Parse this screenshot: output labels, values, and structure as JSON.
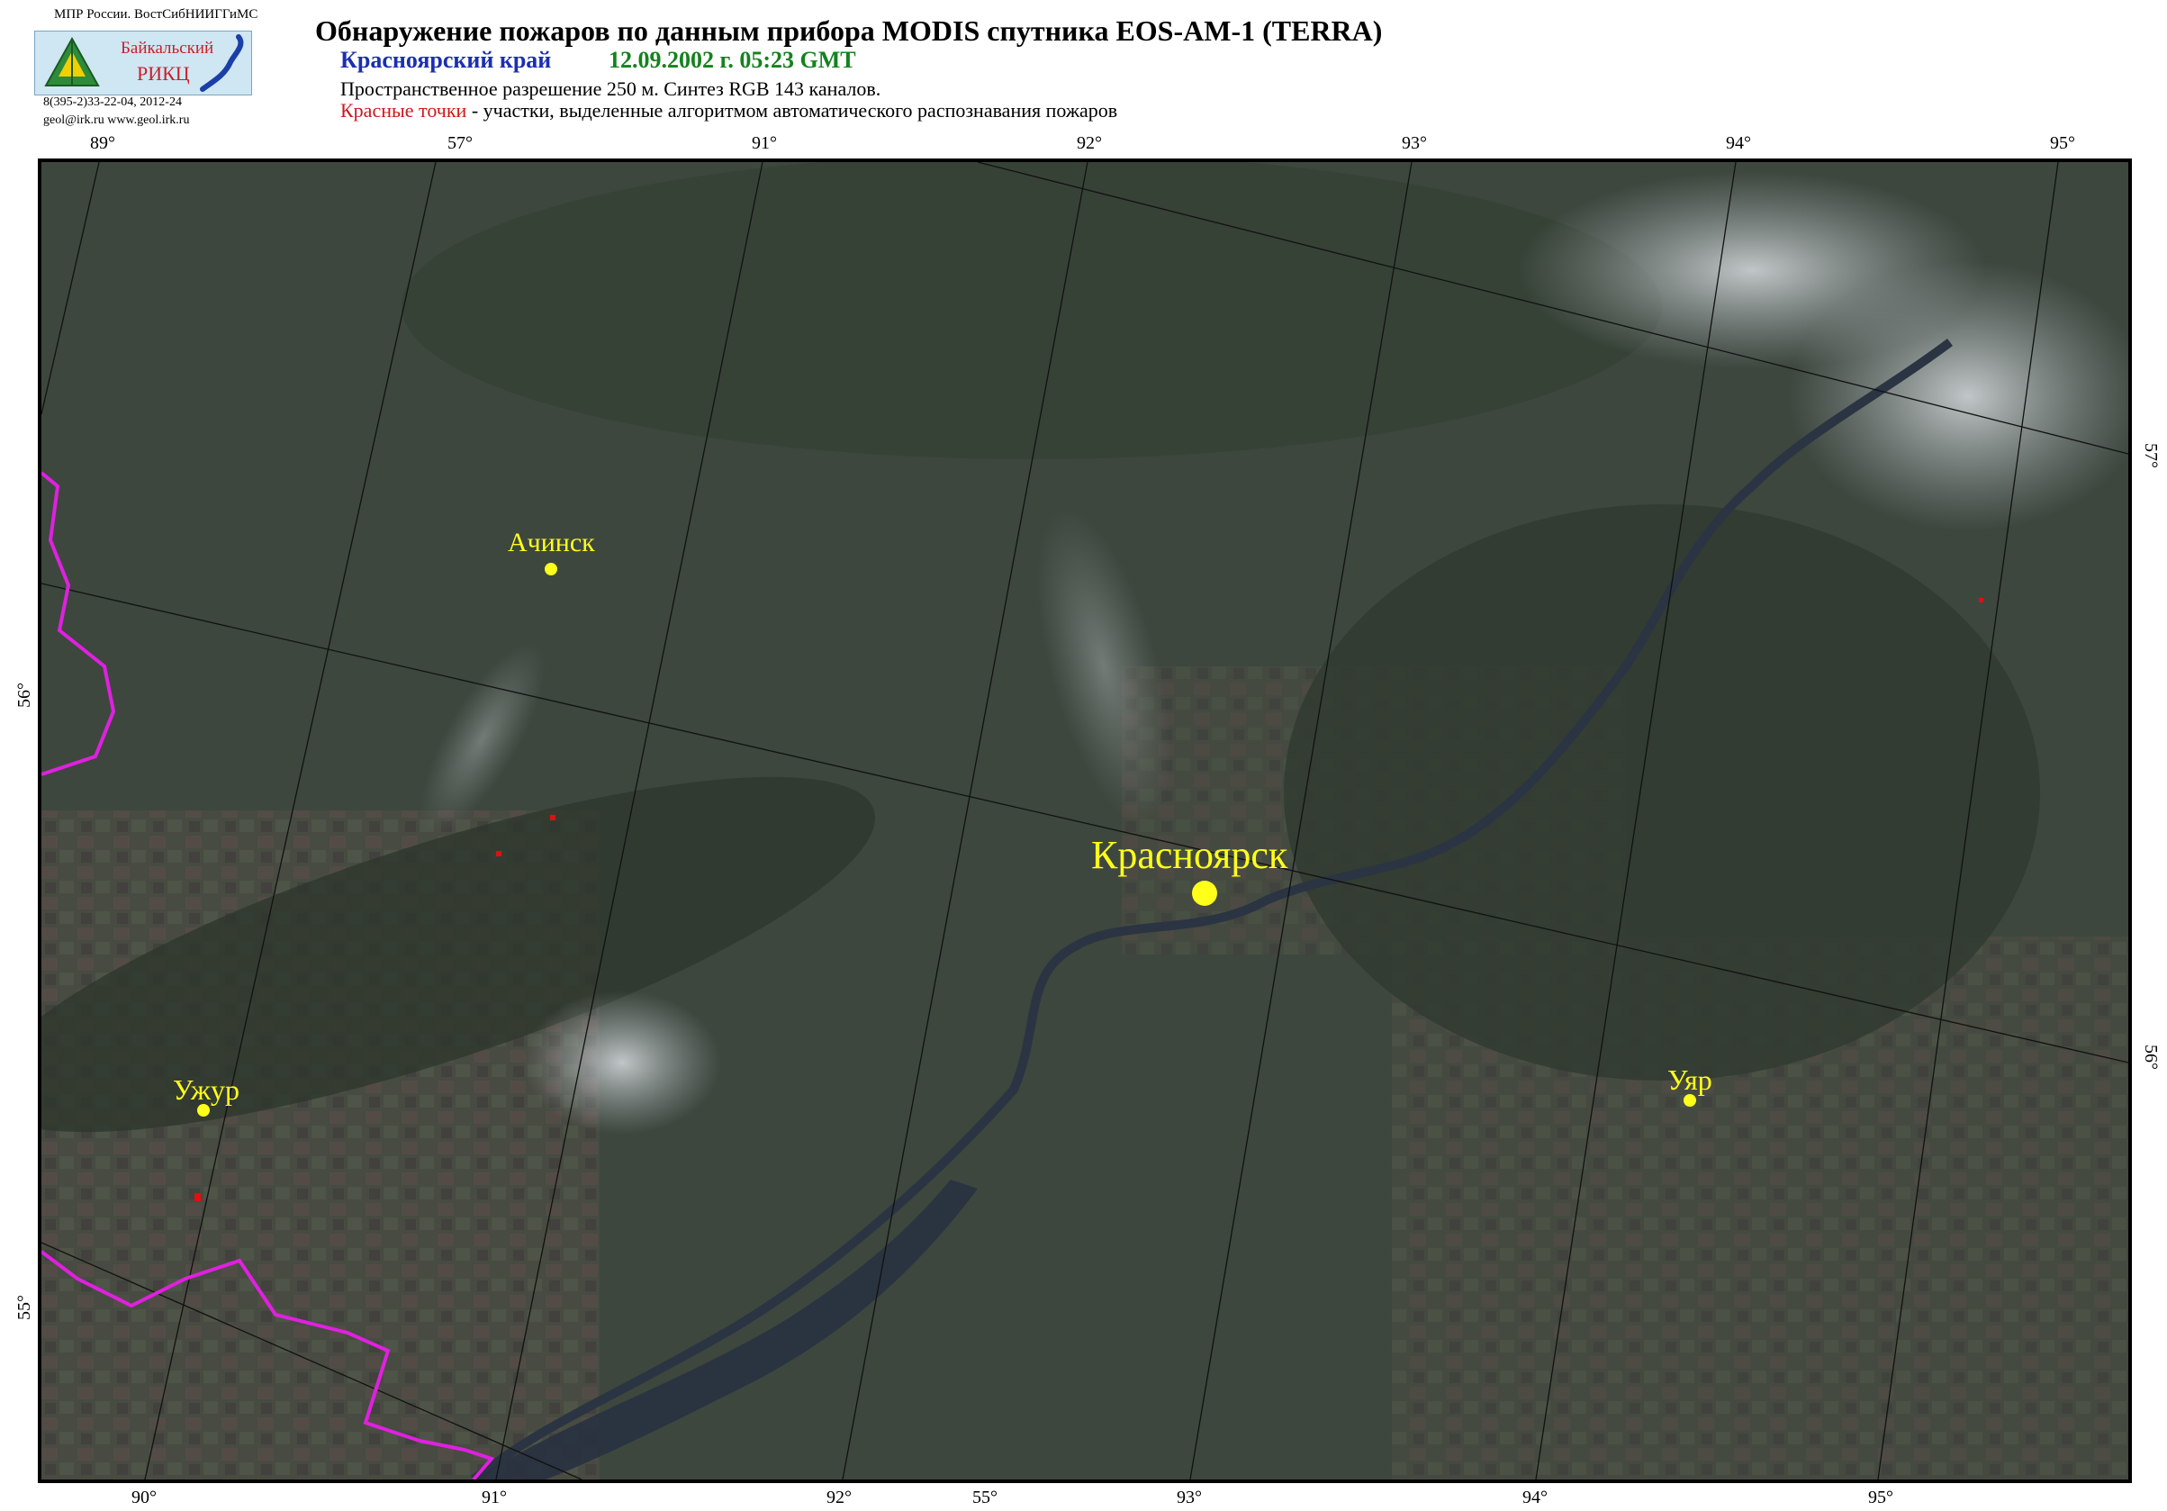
{
  "header": {
    "agency": "МПР России. ВостСибНИИГГиМС",
    "logo_name": "Байкальский",
    "logo_abbr": "РИКЦ",
    "phone": "8(395-2)33-22-04, 2012-24",
    "contacts": "geol@irk.ru  www.geol.irk.ru",
    "title": "Обнаружение пожаров по данным прибора MODIS спутника EOS-AM-1 (TERRA)",
    "region": "Красноярский край",
    "datetime": "12.09.2002 г. 05:23 GMT",
    "resolution": "Пространственное разрешение 250 м. Синтез RGB 143 каналов.",
    "legend_red": "Красные точки",
    "legend_rest": " - участки, выделенные алгоритмом автоматического распознавания пожаров"
  },
  "grid_labels": {
    "top": [
      "89°",
      "57°",
      "91°",
      "92°",
      "93°",
      "94°",
      "95°"
    ],
    "bottom": [
      "90°",
      "91°",
      "92°",
      "55°",
      "93°",
      "94°",
      "95°"
    ],
    "left": [
      "56°",
      "55°"
    ],
    "right": [
      "57°",
      "56°"
    ]
  },
  "cities": {
    "achinsk": "Ачинск",
    "krasnoyarsk": "Красноярск",
    "uzhur": "Ужур",
    "uyar": "Уяр"
  },
  "colors": {
    "terrain": "#3e4a3e",
    "boundary": "#e020e0",
    "city": "#ffff1a",
    "fire": "#e01010",
    "water": "#2a3340"
  }
}
